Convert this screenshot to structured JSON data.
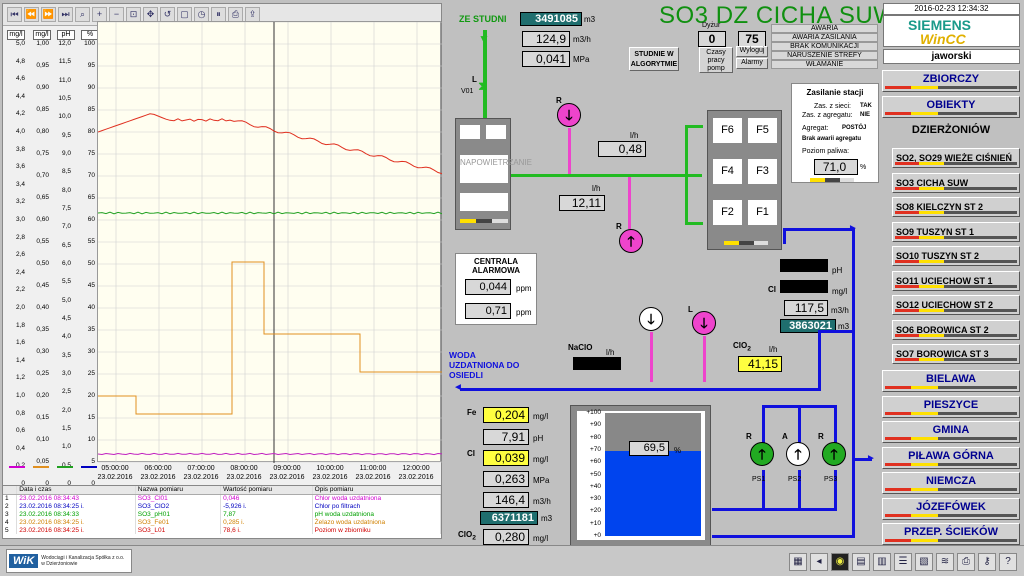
{
  "trend": {
    "units": [
      "mg/l",
      "mg/l",
      "pH",
      "%"
    ],
    "scale_mgl_a": [
      "5,0",
      "4,8",
      "4,6",
      "4,4",
      "4,2",
      "4,0",
      "3,8",
      "3,6",
      "3,4",
      "3,2",
      "3,0",
      "2,8",
      "2,6",
      "2,4",
      "2,2",
      "2,0",
      "1,8",
      "1,6",
      "1,4",
      "1,2",
      "1,0",
      "0,8",
      "0,6",
      "0,4",
      "0,2",
      "0"
    ],
    "scale_mgl_b": [
      "1,00",
      "0,95",
      "0,90",
      "0,85",
      "0,80",
      "0,75",
      "0,70",
      "0,65",
      "0,60",
      "0,55",
      "0,50",
      "0,45",
      "0,40",
      "0,35",
      "0,30",
      "0,25",
      "0,20",
      "0,15",
      "0,10",
      "0,05",
      "0"
    ],
    "scale_ph": [
      "12,0",
      "11,5",
      "11,0",
      "10,5",
      "10,0",
      "9,5",
      "9,0",
      "8,5",
      "8,0",
      "7,5",
      "7,0",
      "6,5",
      "6,0",
      "5,5",
      "5,0",
      "4,5",
      "4,0",
      "3,5",
      "3,0",
      "2,5",
      "2,0",
      "1,5",
      "1,0",
      "0,5",
      "0"
    ],
    "scale_pct": [
      "100",
      "95",
      "90",
      "85",
      "80",
      "75",
      "70",
      "65",
      "60",
      "55",
      "50",
      "45",
      "40",
      "35",
      "30",
      "25",
      "20",
      "15",
      "10",
      "5",
      "0"
    ],
    "x_labels": [
      {
        "t": "05:00:00",
        "d": "23.02.2016"
      },
      {
        "t": "06:00:00",
        "d": "23.02.2016"
      },
      {
        "t": "07:00:00",
        "d": "23.02.2016"
      },
      {
        "t": "08:00:00",
        "d": "23.02.2016"
      },
      {
        "t": "09:00:00",
        "d": "23.02.2016"
      },
      {
        "t": "10:00:00",
        "d": "23.02.2016"
      },
      {
        "t": "11:00:00",
        "d": "23.02.2016"
      },
      {
        "t": "12:00:00",
        "d": "23.02.2016"
      }
    ],
    "table_headers": [
      "",
      "Data i czas",
      "Nazwa pomiaru",
      "Wartość pomiaru",
      "Opis pomiaru"
    ],
    "rows": [
      {
        "n": "1",
        "dt": "23.02.2016 08:34:43",
        "name": "SO3_Cl01",
        "value": "0,046",
        "desc": "Chlor woda uzdatniona",
        "color": "#d000d0"
      },
      {
        "n": "2",
        "dt": "23.02.2016 08:34:25 i.",
        "name": "SO3_ClO2",
        "value": "-5,926 i.",
        "desc": "Chlor po filtrach",
        "color": "#0000c0"
      },
      {
        "n": "3",
        "dt": "23.02.2016 08:34:33",
        "name": "SO3_pH01",
        "value": "7,87",
        "desc": "pH woda uzdatniona",
        "color": "#00a000"
      },
      {
        "n": "4",
        "dt": "23.02.2016 08:34:25 i.",
        "name": "SO3_Fe01",
        "value": "0,285 i.",
        "desc": "Żelazo woda uzdatniona",
        "color": "#d08000"
      },
      {
        "n": "5",
        "dt": "23.02.2016 08:34:25 i.",
        "name": "SO3_L01",
        "value": "78,6 i.",
        "desc": "Poziom w zbiorniku",
        "color": "#d00000"
      }
    ]
  },
  "header": {
    "title": "SO3 DZ CICHA SUW",
    "datetime": "2016-02-23 12:34:32",
    "siemens": "SIEMENS",
    "wincc": "WinCC",
    "user": "jaworski",
    "dyzur_label": "Dyżur",
    "dyzur_a": "0",
    "dyzur_b": "75",
    "czasy": "Czasy pracy pomp",
    "wyloguj": "Wyloguj",
    "alarmy": "Alarmy",
    "studnie_btn": "STUDNIE W ALGORYTMIE",
    "alarms": [
      "AWARIA",
      "AWARIA ZASILANIA",
      "BRAK KOMUNIKACJI",
      "NARUSZENIE STREFY",
      "WŁAMANIE"
    ]
  },
  "schematic": {
    "ze_studni": "ZE STUDNI",
    "counter1": "3491085",
    "counter1_unit": "m3",
    "flow1": "124,9",
    "flow1_unit": "m3/h",
    "press1": "0,041",
    "press1_unit": "MPa",
    "valve_label": "L",
    "valve_id": "V01",
    "aerator": "NAPOWIETRZANIE",
    "pump_r1": "R",
    "pump_r2": "R",
    "val_lh1": "0,48",
    "val_lh1_unit": "l/h",
    "val_lh2": "12,11",
    "val_lh2_unit": "l/h",
    "filters": [
      "F6",
      "F5",
      "F4",
      "F3",
      "F2",
      "F1"
    ],
    "centrala_title": "CENTRALA ALARMOWA",
    "cent_v1": "0,044",
    "cent_v2": "0,71",
    "ppm": "ppm",
    "supply_title": "Zasilanie stacji",
    "supply_rows": [
      {
        "l": "Zas. z sieci:",
        "v": "TAK"
      },
      {
        "l": "Zas. z agregatu:",
        "v": "NIE"
      },
      {
        "l": "Agregat:",
        "v": "POSTÓJ"
      }
    ],
    "brak_awarii": "Brak awarii agregatu",
    "fuel_label": "Poziom paliwa:",
    "fuel_val": "71,0",
    "fuel_unit": "%",
    "ph_unit": "pH",
    "cl_label": "Cl",
    "cl_unit": "mg/l",
    "out_flow": "117,5",
    "out_flow_unit": "m3/h",
    "out_counter": "3863021",
    "out_counter_unit": "m3",
    "naclo": "NaClO",
    "naclo_unit": "l/h",
    "clo2_label": "ClO",
    "clo2_sub": "2",
    "clo2_unit": "l/h",
    "clo2_val": "41,15",
    "woda_label": "WODA UZDATNIONA DO OSIEDLI",
    "pump_l": "L",
    "pump_r3": "R",
    "fe_label": "Fe",
    "fe_val": "0,204",
    "fe_unit": "mg/l",
    "ph_val": "7,91",
    "ph2_unit": "pH",
    "cl2_label": "Cl",
    "cl2_val": "0,039",
    "cl2_unit": "mg/l",
    "press2": "0,263",
    "press2_unit": "MPa",
    "flow2": "146,4",
    "flow2_unit": "m3/h",
    "counter2": "6371181",
    "counter2_unit": "m3",
    "clo2b_label": "ClO",
    "clo2b_sub": "2",
    "clo2b_val": "0,280",
    "clo2b_unit": "mg/l",
    "tank_ticks": [
      "+100",
      "+90",
      "+80",
      "+70",
      "+60",
      "+50",
      "+40",
      "+30",
      "+20",
      "+10",
      "+0"
    ],
    "tank_level": 69.5,
    "tank_level_text": "69,5",
    "tank_unit": "%",
    "ps": [
      {
        "mode": "R",
        "name": "PS1"
      },
      {
        "mode": "A",
        "name": "PS2"
      },
      {
        "mode": "R",
        "name": "PS3"
      }
    ]
  },
  "nav": {
    "zbiorczy": "ZBIORCZY",
    "obiekty": "OBIEKTY",
    "dzierzoniow": "DZIERŻONIÓW",
    "subs": [
      "SO2, SO29  WIEŻE CIŚNIEŃ",
      "SO3 CICHA SUW",
      "SO8 KIELCZYN ST 2",
      "SO9 TUSZYN ST 1",
      "SO10 TUSZYN ST 2",
      "SO11 UCIECHOW ST 1",
      "SO12 UCIECHOW ST 2",
      "SO6 BOROWICA ST 2",
      "SO7 BOROWICA ST 3"
    ],
    "lower": [
      "BIELAWA",
      "PIESZYCE",
      "GMINA",
      "PIŁAWA GÓRNA",
      "NIEMCZA",
      "JÓZEFÓWEK",
      "PRZEP. ŚCIEKÓW"
    ]
  },
  "logo": {
    "wik": "WiK",
    "text": "Wodociągi i Kanalizacja Spółka z o.o. w Dzierżoniowie"
  }
}
